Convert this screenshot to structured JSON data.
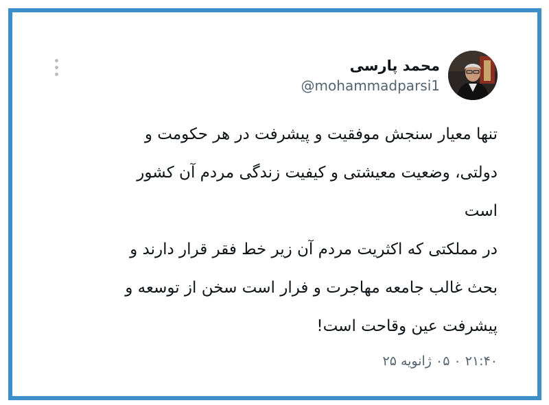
{
  "author": {
    "display_name": "محمد پارسی",
    "handle": "@mohammadparsi1",
    "avatar_icon": "profile-photo"
  },
  "tweet": {
    "lines": [
      "تنها معیار سنجش موفقیت و پیشرفت در هر حکومت و",
      "دولتی، وضعیت معیشتی و کیفیت زندگی مردم آن کشور",
      "است",
      "در مملکتی که اکثریت مردم آن زیر خط فقر قرار دارند و",
      "بحث غالب جامعه مهاجرت و فرار است سخن از توسعه و",
      "پیشرفت عین وقاحت است!"
    ],
    "timestamp": "۲۱:۴۰ ۰ ۰۵ ژانویه ۲۵"
  },
  "colors": {
    "frame": "#3d8ec9",
    "text": "#0f1419",
    "muted": "#536471"
  }
}
